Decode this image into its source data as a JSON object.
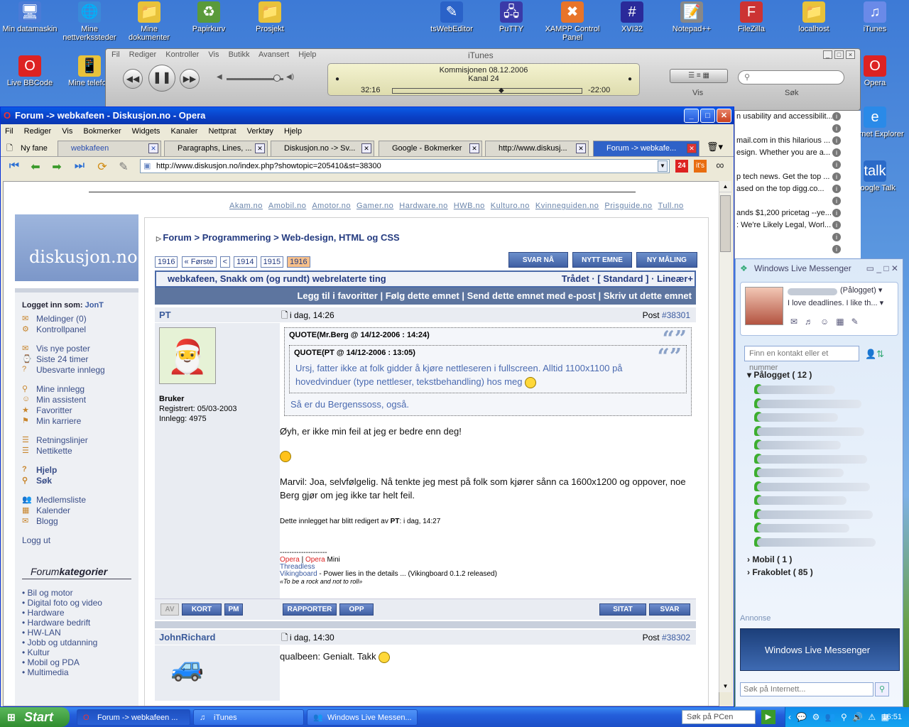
{
  "desktop_icons": [
    {
      "label": "Min datamaskin",
      "glyph": "🖥"
    },
    {
      "label": "Mine nettverkssteder",
      "glyph": "🌐"
    },
    {
      "label": "Mine dokumenter",
      "glyph": "📁"
    },
    {
      "label": "Papirkurv",
      "glyph": "♻"
    },
    {
      "label": "Prosjekt",
      "glyph": "📁"
    },
    {
      "label": "tsWebEditor",
      "glyph": "✎"
    },
    {
      "label": "PuTTY",
      "glyph": "🖧"
    },
    {
      "label": "XAMPP Control Panel",
      "glyph": "✖"
    },
    {
      "label": "XVI32",
      "glyph": "#"
    },
    {
      "label": "Notepad++",
      "glyph": "📝"
    },
    {
      "label": "FileZilla",
      "glyph": "F"
    },
    {
      "label": "localhost",
      "glyph": "📁"
    },
    {
      "label": "iTunes",
      "glyph": "♫"
    },
    {
      "label": "Live BBCode",
      "glyph": "O"
    },
    {
      "label": "Mine telefon",
      "glyph": "📱"
    },
    {
      "label": "Opera",
      "glyph": "O"
    },
    {
      "label": "Internet Explorer",
      "glyph": "e"
    },
    {
      "label": "Google Talk",
      "glyph": "talk"
    }
  ],
  "itunes": {
    "title": "iTunes",
    "menu": [
      "Fil",
      "Rediger",
      "Kontroller",
      "Vis",
      "Butikk",
      "Avansert",
      "Hjelp"
    ],
    "track": "Kommisjonen 08.12.2006",
    "channel": "Kanal 24",
    "elapsed": "32:16",
    "remaining": "-22:00",
    "view_label": "Vis",
    "search_label": "Søk"
  },
  "opera": {
    "title": "Forum -> webkafeen - Diskusjon.no - Opera",
    "menu": [
      "Fil",
      "Rediger",
      "Vis",
      "Bokmerker",
      "Widgets",
      "Kanaler",
      "Nettprat",
      "Verktøy",
      "Hjelp"
    ],
    "tabs": [
      "Ny fane",
      "webkafeen",
      "Paragraphs, Lines, ...",
      "Diskusjon.no -> Sv...",
      "Google - Bokmerker",
      "http://www.diskusj...",
      "Forum -> webkafe..."
    ],
    "url": "http://www.diskusjon.no/index.php?showtopic=205410&st=38300"
  },
  "page": {
    "top_links": [
      "Akam.no",
      "Amobil.no",
      "Amotor.no",
      "Gamer.no",
      "Hardware.no",
      "HWB.no",
      "Kulturo.no",
      "Kvinneguiden.no",
      "Prisguide.no",
      "Tull.no"
    ],
    "logo": "diskusjon.no",
    "logged_in_label": "Logget inn som:",
    "logged_in_user": "JonT",
    "left_groups": [
      [
        "Meldinger (0)",
        "Kontrollpanel"
      ],
      [
        "Vis nye poster",
        "Siste 24 timer",
        "Ubesvarte innlegg"
      ],
      [
        "Mine innlegg",
        "Min assistent",
        "Favoritter",
        "Min karriere"
      ],
      [
        "Retningslinjer",
        "Nettikette"
      ],
      [
        "Hjelp",
        "Søk"
      ],
      [
        "Medlemsliste",
        "Kalender",
        "Blogg"
      ],
      [
        "Logg ut"
      ]
    ],
    "forumkategorier_pre": "Forum",
    "forumkategorier_post": "kategorier",
    "categories": [
      "Bil og motor",
      "Digital foto og video",
      "Hardware",
      "Hardware bedrift",
      "HW-LAN",
      "Jobb og utdanning",
      "Kultur",
      "Mobil og PDA",
      "Multimedia"
    ],
    "breadcrumb": [
      "Forum",
      "Programmering",
      "Web-design, HTML og CSS"
    ],
    "pager": [
      "1916",
      "« Første",
      "<",
      "1914",
      "1915",
      "1916"
    ],
    "actions": [
      "SVAR NÅ",
      "NYTT EMNE",
      "NY MÅLING"
    ],
    "topic_title": "webkafeen, Snakk om (og rundt) webrelaterte ting",
    "topic_modes": "Trådet · [ Standard ] · Lineær+",
    "topic_links": "Legg til i favoritter | Følg dette emnet | Send dette emnet med e-post | Skriv ut dette emnet",
    "post1": {
      "author": "PT",
      "time": "i dag, 14:26",
      "post_label": "Post",
      "post_no": "#38301",
      "rank": "Bruker",
      "registered": "Registrert: 05/03-2003",
      "posts": "Innlegg: 4975",
      "quote_outer": "QUOTE(Mr.Berg @ 14/12-2006 : 14:24)",
      "quote_inner": "QUOTE(PT @ 14/12-2006 : 13:05)",
      "quote_inner_text": "Ursj, fatter ikke at folk gidder å kjøre nettleseren i fullscreen. Alltid 1100x1100 på hovedvinduer (type nettleser, tekstbehandling) hos meg",
      "quote_outer_text": "Så er du Bergenssoss, også.",
      "text1": "Øyh, er ikke min feil at jeg er bedre enn deg!",
      "text2": "Marvil: Joa, selvfølgelig. Nå tenkte jeg mest på folk som kjører sånn ca 1600x1200 og oppover, noe Berg gjør om jeg ikke tar helt feil.",
      "edited_pre": "Dette innlegget har blitt redigert av",
      "edited_user": "PT",
      "edited_post": ": i dag, 14:27",
      "sig_line": "--------------------",
      "sig1a": "Opera",
      "sig1b": "Opera",
      "sig1c": " Mini",
      "sig2": "Threadless",
      "sig3a": "Vikingboard",
      "sig3b": " - Power lies in the details ... (Vikingboard 0.1.2 released)",
      "sig4": "«To be a rock and not to roll»"
    },
    "post_buttons_left": [
      "AV",
      "KORT",
      "PM"
    ],
    "post_buttons_mid": [
      "RAPPORTER",
      "OPP"
    ],
    "post_buttons_right": [
      "SITAT",
      "SVAR"
    ],
    "post2": {
      "author": "JohnRichard",
      "time": "i dag, 14:30",
      "post_label": "Post",
      "post_no": "#38302",
      "text": "qualbeen: Genialt. Takk"
    }
  },
  "rss": [
    "n usability and accessibilit...",
    "",
    "mail.com in this hilarious ...",
    "esign. Whether you are a...",
    "",
    "p tech news. Get the top ...",
    "ased on the top digg.co...",
    "",
    "ands $1,200 pricetag --ye...",
    ": We're Likely Legal, Worl...",
    "",
    ""
  ],
  "msn": {
    "title": "Windows Live Messenger",
    "status": "(Pålogget)",
    "message": "I love deadlines. I like th...",
    "search_placeholder": "Finn en kontakt eller et nummer",
    "group_online": "Pålogget",
    "group_online_count": "( 12 )",
    "group_mobile": "Mobil",
    "group_mobile_count": "( 1 )",
    "group_offline": "Frakoblet",
    "group_offline_count": "( 85 )",
    "ad_label": "Annonse",
    "banner": "Windows Live Messenger",
    "web_search": "Søk på Internett..."
  },
  "taskbar": {
    "start": "Start",
    "buttons": [
      "Forum -> webkafeen ...",
      "iTunes",
      "Windows Live Messen..."
    ],
    "search": "Søk på PCen",
    "clock": "16:51"
  }
}
